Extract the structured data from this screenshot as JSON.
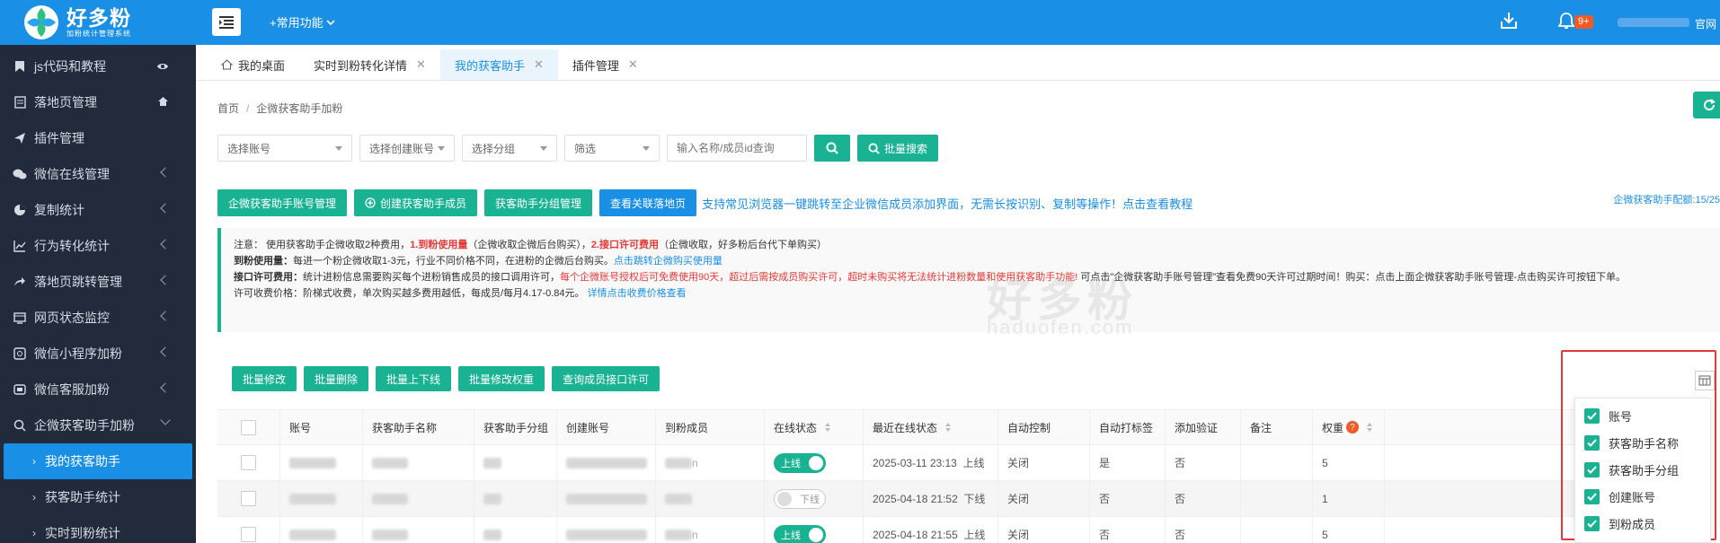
{
  "header": {
    "logo_name": "好多粉",
    "logo_sub": "加粉统计管理系统",
    "common_funcs": "+常用功能",
    "badge": "9+",
    "site_label": "官网"
  },
  "sidebar": {
    "items": [
      {
        "label": "js代码和教程",
        "icon": "bookmark-icon",
        "right": "eye-icon"
      },
      {
        "label": "落地页管理",
        "icon": "document-icon",
        "right": "home-icon"
      },
      {
        "label": "插件管理",
        "icon": "paper-plane-icon",
        "right": ""
      },
      {
        "label": "微信在线管理",
        "icon": "wechat-icon",
        "right": "chevron"
      },
      {
        "label": "复制统计",
        "icon": "pie-chart-icon",
        "right": "chevron"
      },
      {
        "label": "行为转化统计",
        "icon": "line-chart-icon",
        "right": "chevron"
      },
      {
        "label": "落地页跳转管理",
        "icon": "share-icon",
        "right": "chevron"
      },
      {
        "label": "网页状态监控",
        "icon": "monitor-icon",
        "right": "chevron"
      },
      {
        "label": "微信小程序加粉",
        "icon": "mini-program-icon",
        "right": "chevron"
      },
      {
        "label": "微信客服加粉",
        "icon": "customer-service-icon",
        "right": "chevron"
      },
      {
        "label": "企微获客助手加粉",
        "icon": "search-user-icon",
        "right": "chevron-down"
      }
    ],
    "sub_items": [
      {
        "label": "我的获客助手",
        "active": true
      },
      {
        "label": "获客助手统计",
        "active": false
      },
      {
        "label": "实时到粉统计",
        "active": false
      }
    ]
  },
  "tabs": [
    {
      "label": "我的桌面",
      "closable": false,
      "active": false
    },
    {
      "label": "实时到粉转化详情",
      "closable": true,
      "active": false
    },
    {
      "label": "我的获客助手",
      "closable": true,
      "active": true
    },
    {
      "label": "插件管理",
      "closable": true,
      "active": false
    }
  ],
  "breadcrumb": {
    "home": "首页",
    "current": "企微获客助手加粉"
  },
  "filters": {
    "account": "选择账号",
    "creator": "选择创建账号",
    "group": "选择分组",
    "filter": "筛选",
    "search_placeholder": "输入名称/成员id查询",
    "bulk_search": "批量搜索"
  },
  "actions": {
    "account_mgmt": "企微获客助手账号管理",
    "create_member": "创建获客助手成员",
    "group_mgmt": "获客助手分组管理",
    "view_landing": "查看关联落地页",
    "tip": "支持常见浏览器一键跳转至企业微信成员添加界面，无需长按识别、复制等操作！点击查看教程",
    "quota": "企微获客助手配额:15/25"
  },
  "notice": {
    "l1_a": "注意：  使用获客助手企微收取2种费用，",
    "l1_b": "1.到粉使用量",
    "l1_c": "（企微收取企微后台购买），",
    "l1_d": "2.接口许可费用",
    "l1_e": "（企微收取，好多粉后台代下单购买）",
    "l2_a": "到粉使用量：",
    "l2_b": "每进一个粉企微收取1-3元，行业不同价格不同，在进粉的企微后台购买。",
    "l2_c": "点击跳转企微购买使用量",
    "l3_a": "接口许可费用：",
    "l3_b": "统计进粉信息需要购买每个进粉销售成员的接口调用许可，",
    "l3_c": "每个企微账号授权后可免费使用90天，超过后需按成员购买许可，超时未购买将无法统计进粉数量和使用获客助手功能!",
    "l3_d": " 可点击\"企微获客助手账号管理\"查看免费90天许可过期时间！购买：点击上面企微获客助手账号管理-点击购买许可按钮下单。",
    "l4_a": "许可收费价格：阶梯式收费，单次购买越多费用越低，每成员/每月4.17-0.84元。",
    "l4_b": "详情点击收费价格查看"
  },
  "watermark": {
    "cn": "好多粉",
    "en": "haduofen.com"
  },
  "bulk": [
    "批量修改",
    "批量删除",
    "批量上下线",
    "批量修改权重",
    "查询成员接口许可"
  ],
  "table": {
    "headers": [
      "账号",
      "获客助手名称",
      "获客助手分组",
      "创建账号",
      "到粉成员",
      "在线状态",
      "最近在线状态",
      "自动控制",
      "自动打标签",
      "添加验证",
      "备注",
      "权重"
    ],
    "rows": [
      {
        "status_on": true,
        "toggle": "上线",
        "last_time": "2025-03-11 23:13",
        "last_state": "上线",
        "auto_ctrl": "关闭",
        "auto_tag": "是",
        "verify": "否",
        "weight": "5",
        "member_tail": "n"
      },
      {
        "status_on": false,
        "toggle": "下线",
        "last_time": "2025-04-18 21:52",
        "last_state": "下线",
        "auto_ctrl": "关闭",
        "auto_tag": "否",
        "verify": "否",
        "weight": "1",
        "member_tail": ""
      },
      {
        "status_on": true,
        "toggle": "上线",
        "last_time": "2025-04-18 21:55",
        "last_state": "上线",
        "auto_ctrl": "关闭",
        "auto_tag": "否",
        "verify": "否",
        "weight": "5",
        "member_tail": "n"
      }
    ]
  },
  "column_menu": [
    "账号",
    "获客助手名称",
    "获客助手分组",
    "创建账号",
    "到粉成员"
  ],
  "colors": {
    "primary": "#1a8fe6",
    "teal": "#19b394",
    "sidebar": "#212b3c",
    "alert": "#e53935"
  }
}
